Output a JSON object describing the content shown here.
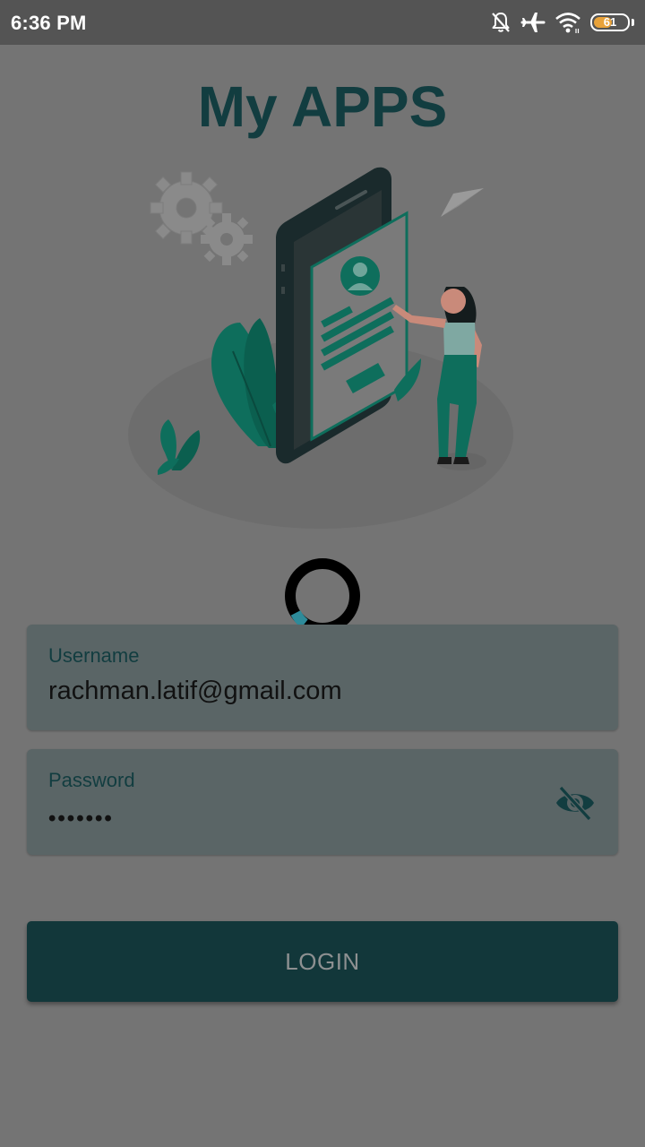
{
  "status_bar": {
    "time": "6:36 PM",
    "icons": [
      "bell-off-icon",
      "airplane-icon",
      "wifi-icon",
      "battery-icon"
    ],
    "battery_level": "61",
    "battery_fraction": 0.61
  },
  "app": {
    "title": "My APPS"
  },
  "loading": true,
  "form": {
    "username": {
      "label": "Username",
      "value": "rachman.latif@gmail.com"
    },
    "password": {
      "label": "Password",
      "value": "•••••••",
      "toggle_icon": "eye-off-icon"
    }
  },
  "login_button": {
    "label": "LOGIN"
  },
  "colors": {
    "accent": "#123d40",
    "illustration_green": "#0e6e5c",
    "overlay_background": "#747474",
    "field_background": "#5a6566",
    "button_background": "#12373a",
    "spinner_ring": "#000000",
    "spinner_accent": "#2e8b9a"
  }
}
